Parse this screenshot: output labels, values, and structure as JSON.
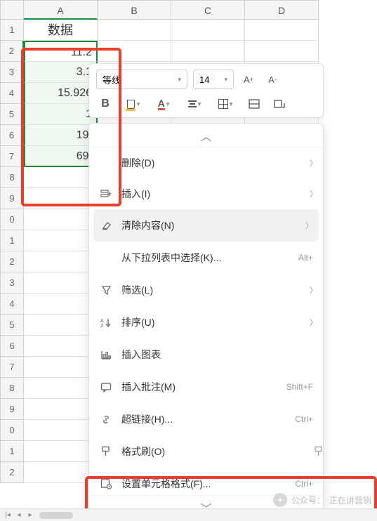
{
  "columns": [
    "A",
    "B",
    "C",
    "D"
  ],
  "rows": [
    {
      "num": "1",
      "a": "数据",
      "header": true
    },
    {
      "num": "2",
      "a": "11.2"
    },
    {
      "num": "3",
      "a": "3.1"
    },
    {
      "num": "4",
      "a": "15.926"
    },
    {
      "num": "5",
      "a": "1"
    },
    {
      "num": "6",
      "a": "19."
    },
    {
      "num": "7",
      "a": "69."
    },
    {
      "num": "8",
      "a": ""
    },
    {
      "num": "9",
      "a": ""
    },
    {
      "num": "0",
      "a": ""
    },
    {
      "num": "1",
      "a": ""
    },
    {
      "num": "2",
      "a": ""
    },
    {
      "num": "3",
      "a": ""
    },
    {
      "num": "4",
      "a": ""
    },
    {
      "num": "5",
      "a": ""
    },
    {
      "num": "6",
      "a": ""
    },
    {
      "num": "7",
      "a": ""
    },
    {
      "num": "8",
      "a": ""
    },
    {
      "num": "9",
      "a": ""
    },
    {
      "num": "0",
      "a": ""
    },
    {
      "num": "1",
      "a": ""
    },
    {
      "num": "2",
      "a": ""
    }
  ],
  "selection": {
    "from_row": 2,
    "to_row": 7,
    "col": "A"
  },
  "toolbar": {
    "font_name": "等线",
    "font_size": "14",
    "bold": "B",
    "font_color": "A",
    "increase": "A",
    "inc_sup": "+",
    "decrease": "A",
    "dec_sup": "-"
  },
  "menu": {
    "delete": "删除(D)",
    "insert": "插入(I)",
    "clear": "清除内容(N)",
    "dropdown": "从下拉列表中选择(K)...",
    "dropdown_shortcut": "Alt+",
    "filter": "筛选(L)",
    "sort": "排序(U)",
    "chart": "插入图表",
    "comment": "插入批注(M)",
    "comment_shortcut": "Shift+F",
    "hyperlink": "超链接(H)...",
    "hyperlink_shortcut": "Ctrl+",
    "format_painter": "格式刷(O)",
    "cell_format": "设置单元格格式(F)...",
    "cell_format_shortcut": "Ctrl+"
  },
  "collapse_up": "︿",
  "collapse_down": "﹀",
  "watermark": {
    "prefix": "公众号：",
    "name": "正在讲营销"
  }
}
